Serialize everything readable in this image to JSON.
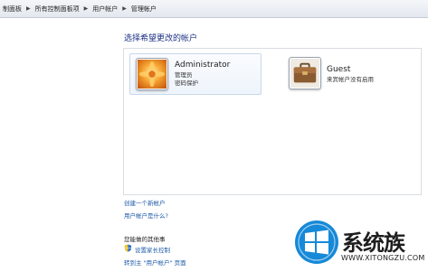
{
  "breadcrumb": [
    "制面板",
    "所有控制面板项",
    "用户帐户",
    "管理帐户"
  ],
  "heading": "选择希望更改的帐户",
  "accounts": [
    {
      "name": "Administrator",
      "details": [
        "管理员",
        "密码保护"
      ],
      "picture_icon": "flower-picture-icon"
    },
    {
      "name": "Guest",
      "details": [
        "来宾帐户没有启用"
      ],
      "picture_icon": "briefcase-picture-icon"
    }
  ],
  "links": {
    "create": "创建一个新帐户",
    "what_is": "用户帐户是什么?"
  },
  "other_tasks": {
    "title": "您能做的其他事",
    "items": [
      "设置家长控制",
      "转到主 \"用户帐户\" 页面"
    ]
  },
  "watermark": {
    "title": "系统族",
    "url": "WWW.XITONGZU.COM"
  },
  "colors": {
    "heading": "#1e3287",
    "link": "#1e5aa8",
    "win_logo": "#1689d8"
  }
}
